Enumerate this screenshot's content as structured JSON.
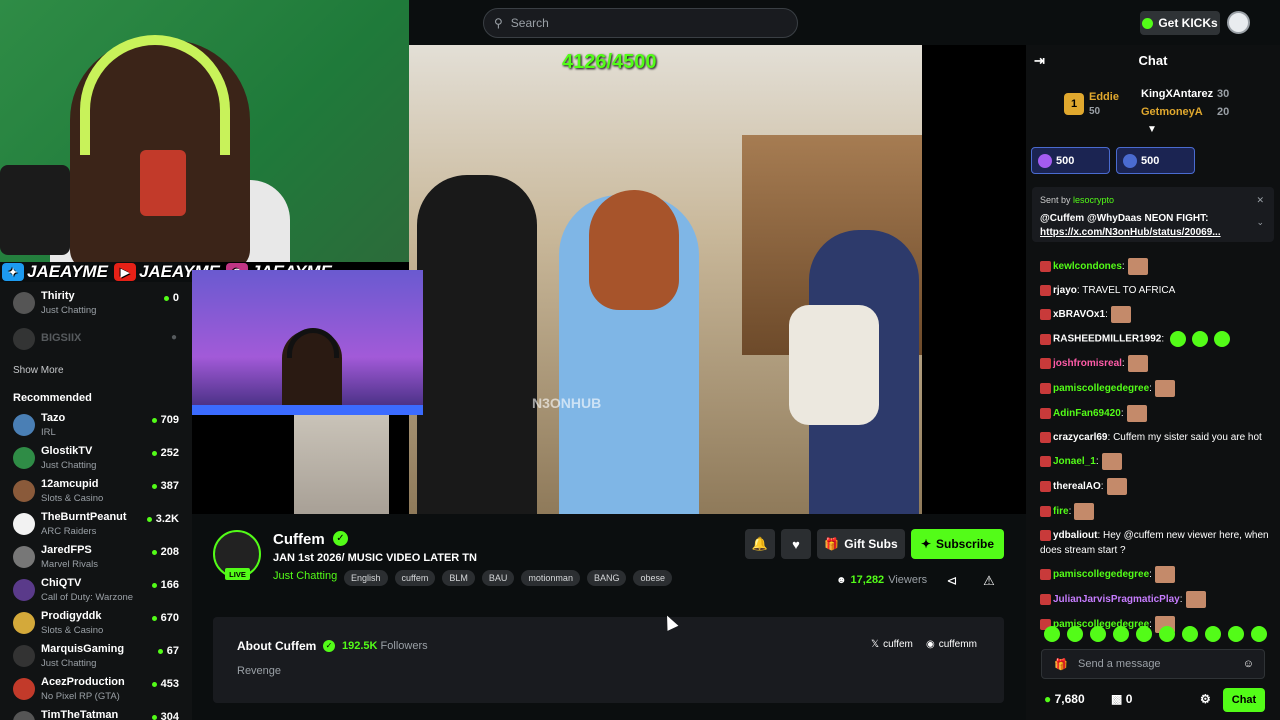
{
  "search": {
    "placeholder": "Search"
  },
  "header": {
    "get_kicks": "Get KICKs"
  },
  "overlay": {
    "counter": "4126/4500",
    "watermark": "N3ONHUB",
    "socials": [
      "JAEAYME",
      "JAEAYME",
      "JAEAYME"
    ]
  },
  "sidebar": {
    "following": [
      {
        "name": "Thirity",
        "category": "Just Chatting",
        "viewers": "0"
      },
      {
        "name": "BIGSIIX",
        "category": "",
        "viewers": ""
      }
    ],
    "show_more": "Show More",
    "recommended_label": "Recommended",
    "recommended": [
      {
        "name": "Tazo",
        "category": "IRL",
        "viewers": "709",
        "color": "#4a7fb5"
      },
      {
        "name": "GlostikTV",
        "category": "Just Chatting",
        "viewers": "252",
        "color": "#2f8c46"
      },
      {
        "name": "12amcupid",
        "category": "Slots & Casino",
        "viewers": "387",
        "color": "#8a5a3a"
      },
      {
        "name": "TheBurntPeanut",
        "category": "ARC Raiders",
        "viewers": "3.2K",
        "color": "#f2f2f2"
      },
      {
        "name": "JaredFPS",
        "category": "Marvel Rivals",
        "viewers": "208",
        "color": "#777777"
      },
      {
        "name": "ChiQTV",
        "category": "Call of Duty: Warzone",
        "viewers": "166",
        "color": "#5a3a8a"
      },
      {
        "name": "Prodigyddk",
        "category": "Slots & Casino",
        "viewers": "670",
        "color": "#d4a93a"
      },
      {
        "name": "MarquisGaming",
        "category": "Just Chatting",
        "viewers": "67",
        "color": "#333333"
      },
      {
        "name": "AcezProduction",
        "category": "No Pixel RP (GTA)",
        "viewers": "453",
        "color": "#c23a2a"
      },
      {
        "name": "TimTheTatman",
        "category": "",
        "viewers": "304",
        "color": "#555555"
      }
    ]
  },
  "channel": {
    "live_badge": "LIVE",
    "name": "Cuffem",
    "title": "JAN 1st 2026/ MUSIC VIDEO LATER TN",
    "category": "Just Chatting",
    "tags": [
      "English",
      "cuffem",
      "BLM",
      "BAU",
      "motionman",
      "BANG",
      "obese"
    ],
    "gift_subs": "Gift Subs",
    "subscribe": "Subscribe",
    "viewers_count": "17,282",
    "viewers_label": "Viewers"
  },
  "about": {
    "title": "About Cuffem",
    "followers_count": "192.5K",
    "followers_label": "Followers",
    "bio": "Revenge",
    "x_handle": "cuffem",
    "ig_handle": "cuffemm"
  },
  "chat": {
    "title": "Chat",
    "leaderboard": [
      {
        "name": "Eddie",
        "amount": "50"
      },
      {
        "name": "KingXAntarez",
        "amount": "30"
      },
      {
        "name": "GetmoneyA",
        "amount": "20"
      }
    ],
    "pills": [
      "500",
      "500"
    ],
    "pinned": {
      "sent_by_label": "Sent by",
      "sender": "lesocrypto",
      "message": "@Cuffem @WhyDaas NEON FIGHT:",
      "link": "https://x.com/N3onHub/status/20069..."
    },
    "messages": [
      {
        "user": "kewlcondones",
        "text": "",
        "color": "#53fc18",
        "emote": true
      },
      {
        "user": "rjayo",
        "text": "TRAVEL TO AFRICA",
        "color": "#ffffff",
        "emote": false
      },
      {
        "user": "xBRAVOx1",
        "text": "",
        "color": "#ffffff",
        "emote": true
      },
      {
        "user": "RASHEEDMILLER1992",
        "text": "",
        "color": "#ffffff",
        "emote": false,
        "green": true
      },
      {
        "user": "joshfromisreal",
        "text": "",
        "color": "#ff5ca8",
        "emote": true
      },
      {
        "user": "pamiscollegedegree",
        "text": "",
        "color": "#53fc18",
        "emote": true
      },
      {
        "user": "AdinFan69420",
        "text": "",
        "color": "#53fc18",
        "emote": true
      },
      {
        "user": "crazycarl69",
        "text": "Cuffem my sister said you are hot",
        "color": "#ffffff",
        "emote": false
      },
      {
        "user": "Jonael_1",
        "text": "",
        "color": "#53fc18",
        "emote": true
      },
      {
        "user": "therealAO",
        "text": "",
        "color": "#ffffff",
        "emote": true
      },
      {
        "user": "fire",
        "text": "",
        "color": "#53fc18",
        "emote": true
      },
      {
        "user": "ydbaliout",
        "text": "Hey @cuffem new viewer here, when does stream start ?",
        "color": "#ffffff",
        "emote": false
      },
      {
        "user": "pamiscollegedegree",
        "text": "",
        "color": "#53fc18",
        "emote": true
      },
      {
        "user": "JulianJarvisPragmaticPlay",
        "text": "",
        "color": "#c77dff",
        "emote": true
      },
      {
        "user": "pamiscollegedegree",
        "text": "",
        "color": "#53fc18",
        "emote": true
      }
    ],
    "input_placeholder": "Send a message",
    "points": "7,680",
    "gifts": "0",
    "chat_button": "Chat"
  }
}
